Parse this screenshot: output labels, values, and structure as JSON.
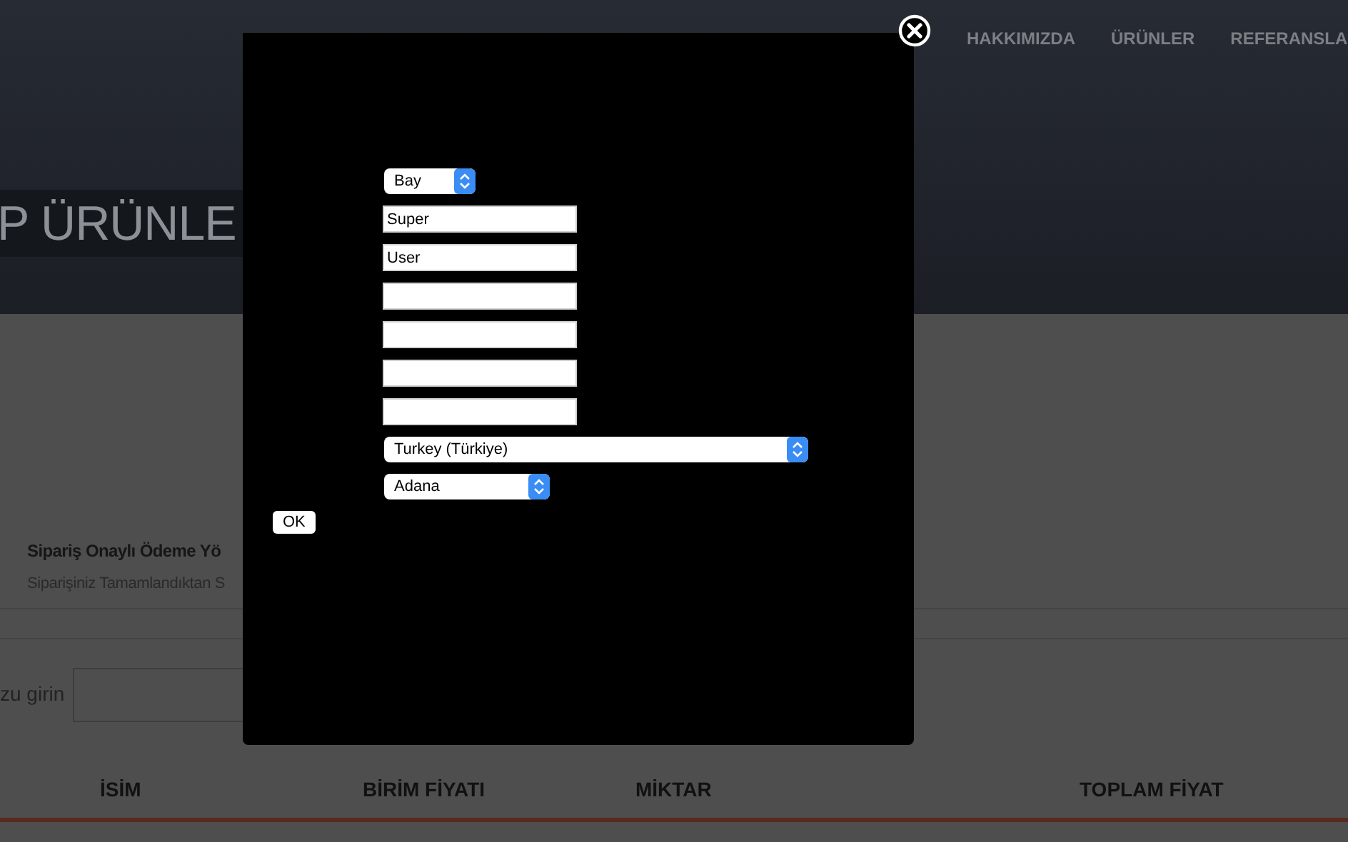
{
  "nav": [
    {
      "label": "HAKKIMIZDA"
    },
    {
      "label": "ÜRÜNLER"
    },
    {
      "label": "REFERANSLA"
    }
  ],
  "hero_title": "P ÜRÜNLE",
  "payment": {
    "title": "Sipariş Onaylı Ödeme Yö",
    "text": "Siparişiniz Tamamlandıktan S"
  },
  "search": {
    "label": "zu girin"
  },
  "table": {
    "columns": [
      "İSİM",
      "BİRİM FİYATI",
      "MİKTAR",
      "TOPLAM FİYAT"
    ]
  },
  "dialog": {
    "fields": [
      {
        "kind": "select",
        "value": "Bay"
      },
      {
        "kind": "text",
        "value": "Super"
      },
      {
        "kind": "text",
        "value": "User"
      },
      {
        "kind": "text"
      },
      {
        "kind": "text"
      },
      {
        "kind": "text"
      },
      {
        "kind": "text"
      },
      {
        "kind": "select",
        "value": "Turkey (Türkiye)"
      },
      {
        "kind": "select",
        "value": "Adana"
      }
    ],
    "button": "OK"
  }
}
